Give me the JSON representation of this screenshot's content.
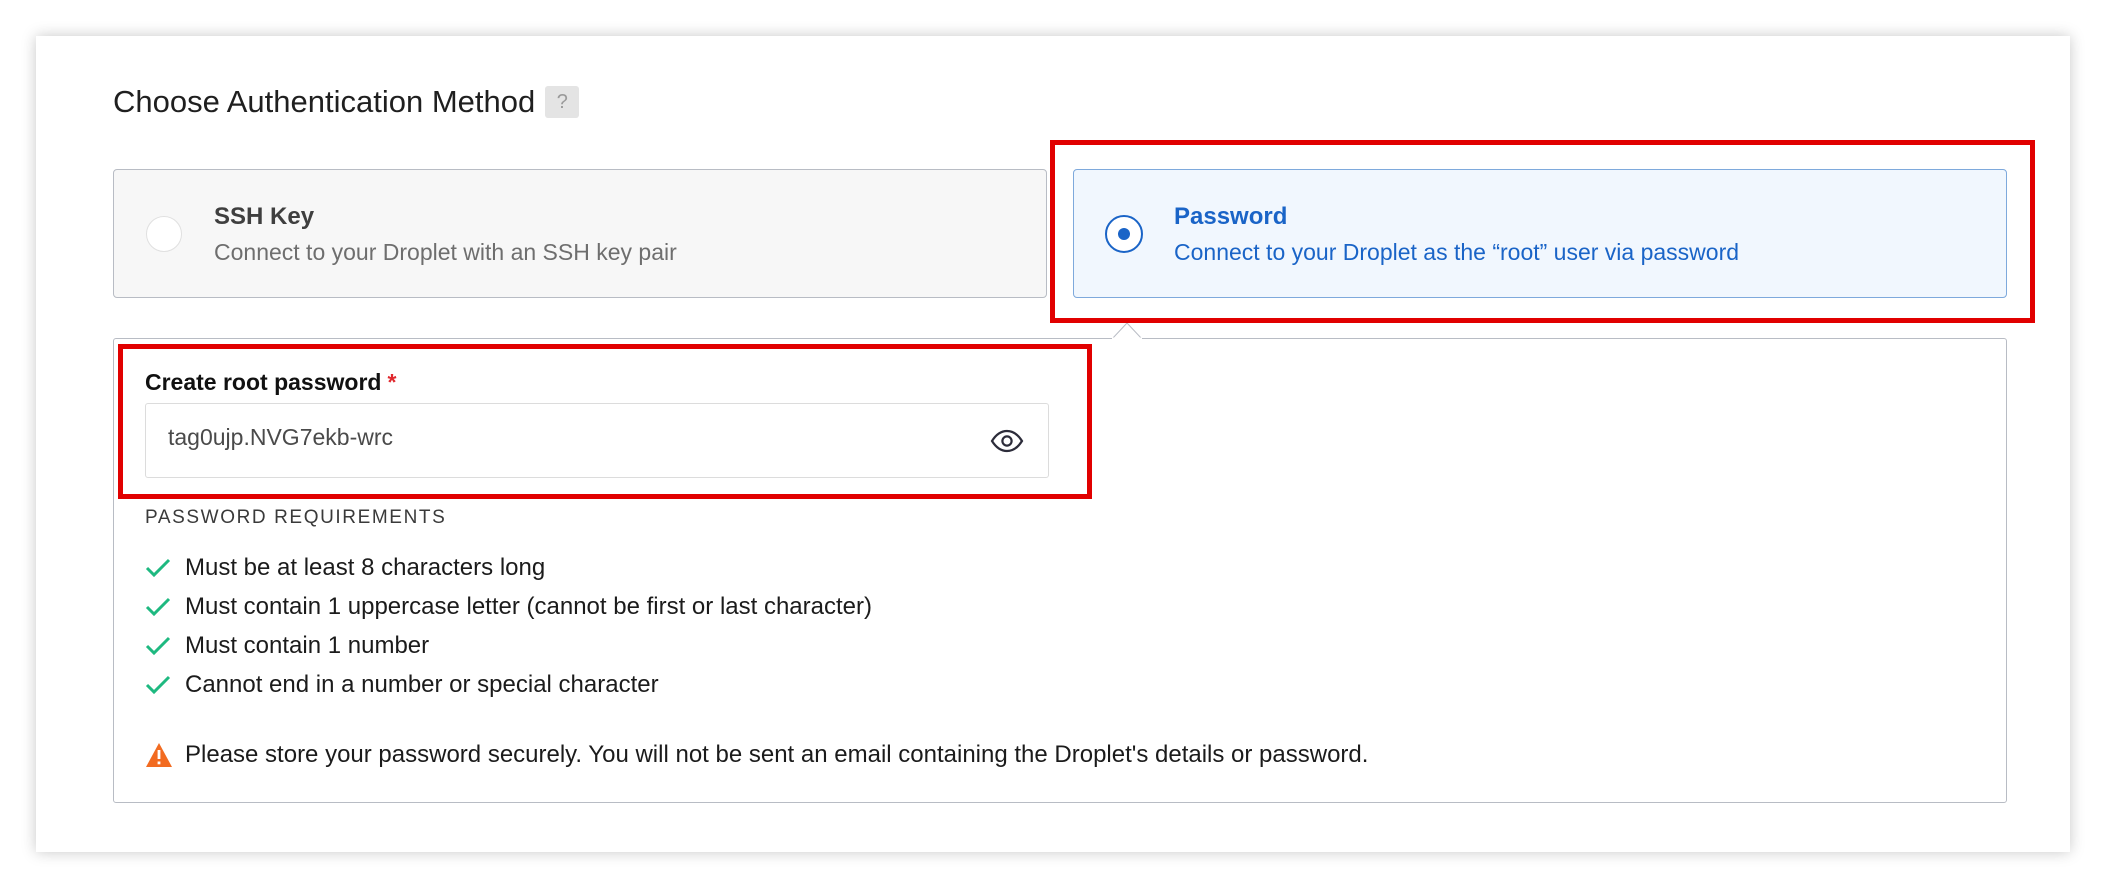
{
  "section": {
    "title": "Choose Authentication Method",
    "help_label": "?"
  },
  "options": [
    {
      "title": "SSH Key",
      "description": "Connect to your Droplet with an SSH key pair",
      "selected": false
    },
    {
      "title": "Password",
      "description": "Connect to your Droplet as the “root” user via password",
      "selected": true
    }
  ],
  "password_form": {
    "label": "Create root password",
    "required_marker": "*",
    "value": "tag0ujp.NVG7ekb-wrc",
    "requirements_heading": "PASSWORD REQUIREMENTS",
    "requirements": [
      "Must be at least 8 characters long",
      "Must contain 1 uppercase letter (cannot be first or last character)",
      "Must contain 1 number",
      "Cannot end in a number or special character"
    ],
    "warning": "Please store your password securely. You will not be sent an email containing the Droplet's details or password."
  },
  "icons": {
    "help": "question-mark-icon",
    "reveal": "eye-icon",
    "requirement_met": "checkmark-icon",
    "warning": "warning-triangle-icon"
  },
  "colors": {
    "accent": "#1a64c7",
    "check": "#1eb980",
    "warning": "#f26b21",
    "required": "#e0282e",
    "annotation": "#e10000"
  }
}
